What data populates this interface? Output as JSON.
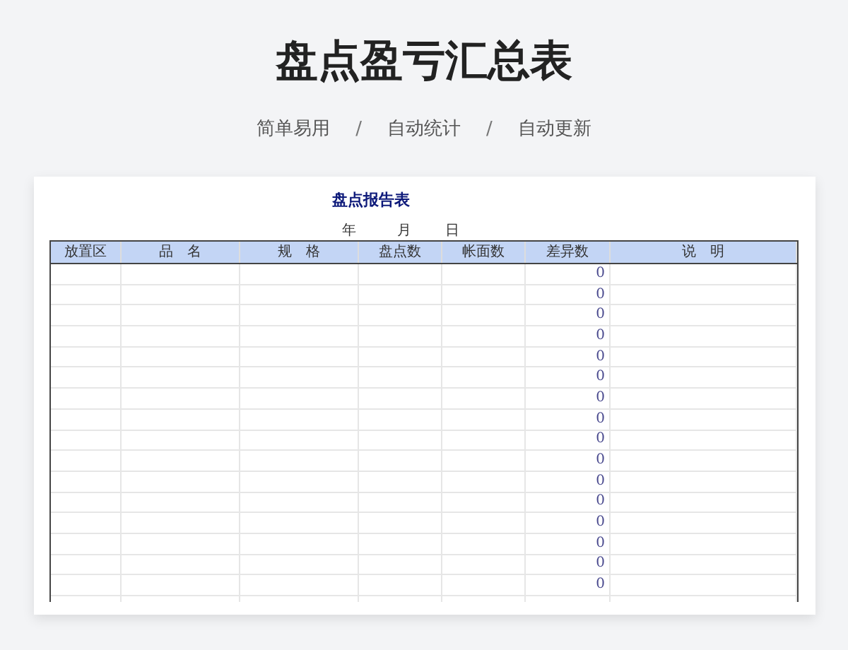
{
  "page_title": "盘点盈亏汇总表",
  "features": [
    "简单易用",
    "自动统计",
    "自动更新"
  ],
  "separator": "/",
  "sheet": {
    "title": "盘点报告表",
    "date_labels": [
      "年",
      "月",
      "日"
    ],
    "columns": [
      "放置区",
      "品　名",
      "规　格",
      "盘点数",
      "帐面数",
      "差异数",
      "说　明"
    ],
    "rows": [
      {
        "difference": "0"
      },
      {
        "difference": "0"
      },
      {
        "difference": "0"
      },
      {
        "difference": "0"
      },
      {
        "difference": "0"
      },
      {
        "difference": "0"
      },
      {
        "difference": "0"
      },
      {
        "difference": "0"
      },
      {
        "difference": "0"
      },
      {
        "difference": "0"
      },
      {
        "difference": "0"
      },
      {
        "difference": "0"
      },
      {
        "difference": "0"
      },
      {
        "difference": "0"
      },
      {
        "difference": "0"
      },
      {
        "difference": "0"
      }
    ]
  }
}
